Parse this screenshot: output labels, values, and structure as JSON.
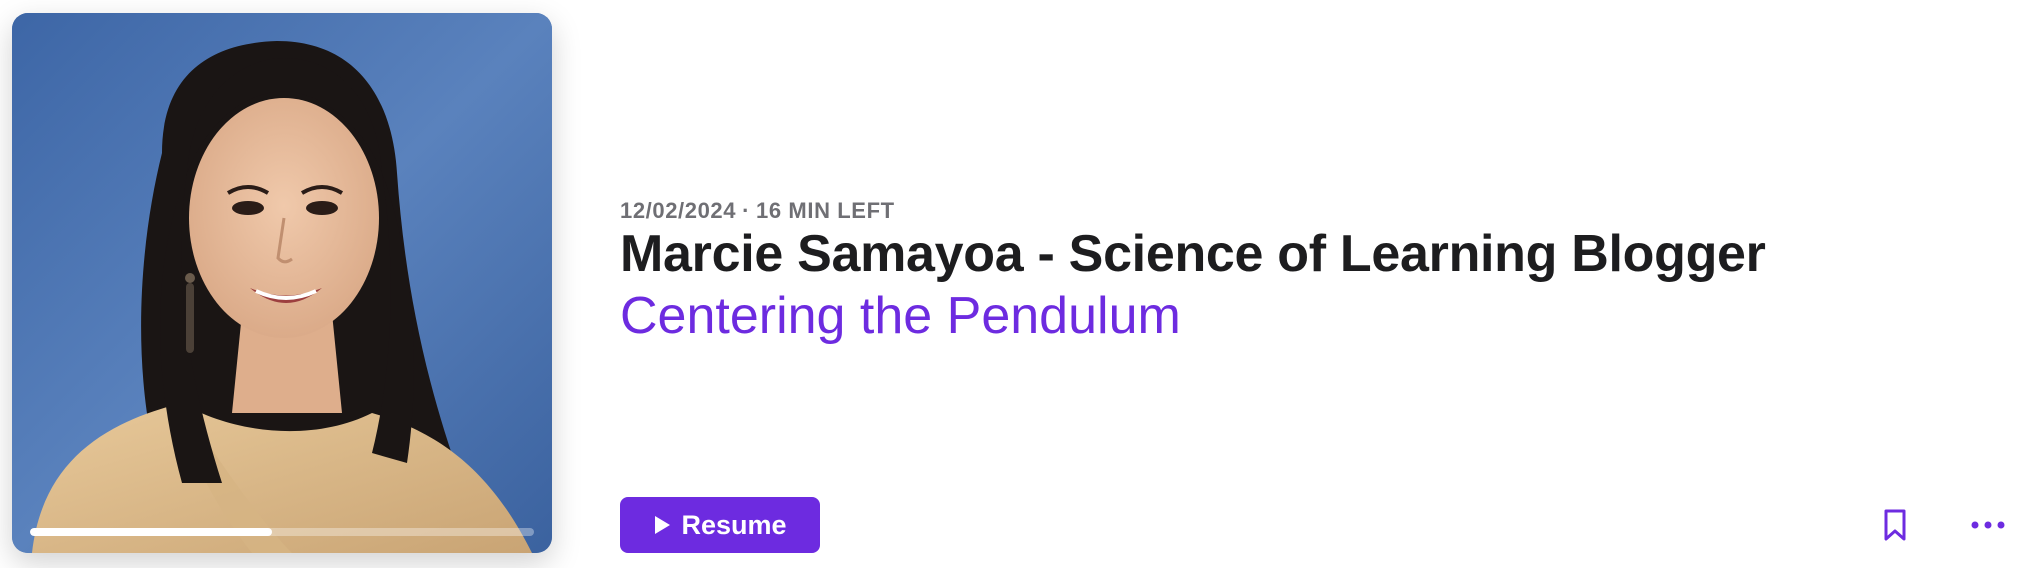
{
  "episode": {
    "date": "12/02/2024",
    "separator": "·",
    "time_left": "16 MIN LEFT",
    "show_title": "Marcie Samayoa - Science of Learning Blogger",
    "episode_title": "Centering the Pendulum",
    "progress_fraction": 0.48
  },
  "actions": {
    "resume_label": "Resume",
    "play_icon": "play-icon",
    "bookmark_icon": "bookmark-icon",
    "more_icon": "more-icon"
  },
  "colors": {
    "accent": "#6d2be0",
    "title": "#1d1d1f",
    "meta": "#6f6f74"
  }
}
